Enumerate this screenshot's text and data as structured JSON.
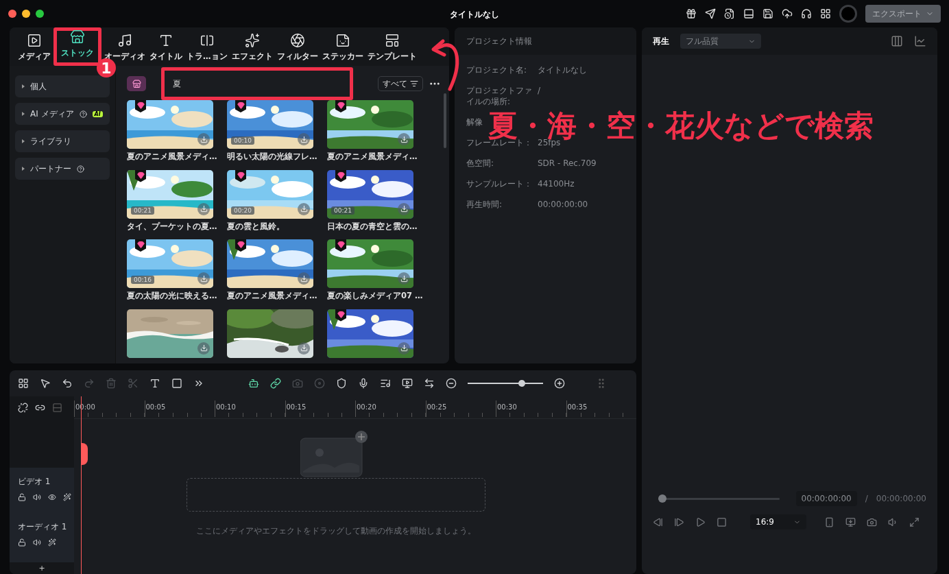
{
  "window": {
    "title": "タイトルなし",
    "export_button": "エクスポート"
  },
  "media_tabs": [
    {
      "label": "メディア",
      "selected": false
    },
    {
      "label": "ストック",
      "selected": true
    },
    {
      "label": "オーディオ",
      "selected": false
    },
    {
      "label": "タイトル",
      "selected": false
    },
    {
      "label": "トラ…ョン",
      "selected": false
    },
    {
      "label": "エフェクト",
      "selected": false
    },
    {
      "label": "フィルター",
      "selected": false
    },
    {
      "label": "ステッカー",
      "selected": false
    },
    {
      "label": "テンプレート",
      "selected": false
    }
  ],
  "sidebar": {
    "items": [
      {
        "label": "個人",
        "help": false
      },
      {
        "label": "AI メディア",
        "help": true,
        "badge": "AI"
      },
      {
        "label": "ライブラリ",
        "help": false
      },
      {
        "label": "パートナー",
        "help": true
      }
    ]
  },
  "search": {
    "value": "夏",
    "filter_button": "すべて"
  },
  "stock_items": [
    {
      "title": "夏のアニメ風景メディ…",
      "premium": true
    },
    {
      "title": "明るい太陽の光線フレ…",
      "duration": "00:10",
      "premium": true
    },
    {
      "title": "夏のアニメ風景メディ…",
      "premium": true
    },
    {
      "title": "タイ、プーケットの夏…",
      "duration": "00:21",
      "premium": true
    },
    {
      "title": "夏の雲と風鈴。",
      "duration": "00:20",
      "premium": true
    },
    {
      "title": "日本の夏の青空と雲の…",
      "duration": "00:21",
      "premium": true
    },
    {
      "title": "夏の太陽の光に映える…",
      "duration": "00:16",
      "premium": true
    },
    {
      "title": "夏のアニメ風景メディ…",
      "premium": true
    },
    {
      "title": "夏の楽しみメディア07 …",
      "premium": true
    },
    {
      "premium": false
    },
    {
      "premium": false
    },
    {
      "premium": true
    }
  ],
  "project_info": {
    "title": "プロジェクト情報",
    "rows": [
      {
        "label": "プロジェクト名:",
        "value": "タイトルなし"
      },
      {
        "label": "プロジェクトファイルの場所:",
        "value": "/"
      },
      {
        "label": "解像"
      },
      {
        "label": "フレームレート：",
        "value": "25fps"
      },
      {
        "label": "色空間:",
        "value": "SDR - Rec.709"
      },
      {
        "label": "サンプルレート：",
        "value": "44100Hz"
      },
      {
        "label": "再生時間:",
        "value": "00:00:00:00"
      }
    ]
  },
  "player": {
    "tab": "再生",
    "quality": "フル品質",
    "progress": {
      "level": 0
    },
    "current_time": "00:00:00:00",
    "separator": "/",
    "total_time": "00:00:00:00",
    "aspect": "16:9"
  },
  "timeline": {
    "tools": [
      {
        "disabled": false
      },
      {
        "disabled": false
      },
      {
        "disabled": false
      },
      {
        "disabled": true
      },
      {
        "disabled": true
      },
      {
        "disabled": true
      },
      {
        "disabled": false
      },
      {
        "disabled": false
      },
      {
        "disabled": false
      },
      {
        "disabled": false
      },
      {
        "disabled": false
      },
      {
        "disabled": true
      },
      {
        "disabled": true
      },
      {
        "disabled": false
      },
      {
        "disabled": false
      },
      {
        "disabled": false
      },
      {
        "disabled": false
      },
      {
        "disabled": false
      }
    ],
    "zoom": {
      "level": 0.74
    },
    "ruler": [
      "00:00",
      "00:05",
      "00:10",
      "00:15",
      "00:20",
      "00:25",
      "00:30",
      "00:35"
    ],
    "tracks": [
      {
        "kind": "video",
        "name": "ビデオ 1"
      },
      {
        "kind": "audio",
        "name": "オーディオ 1"
      }
    ],
    "add_track": "+",
    "drop_hint": "ここにメディアやエフェクトをドラッグして動画の作成を開始しましょう。"
  },
  "annotation": {
    "step": "1",
    "callout": "夏・海・空・花火などで検索"
  }
}
